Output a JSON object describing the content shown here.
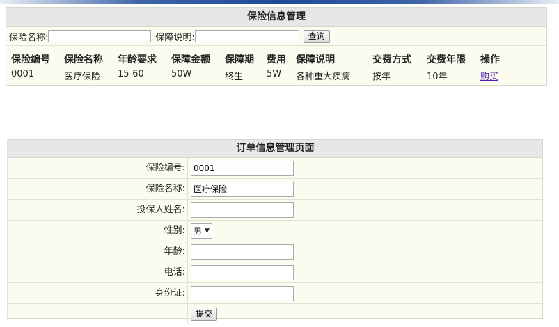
{
  "insurance_panel": {
    "title": "保险信息管理",
    "search": {
      "name_label": "保险名称:",
      "desc_label": "保障说明:",
      "name_value": "",
      "desc_value": "",
      "query_button": "查询"
    },
    "columns": [
      "保险编号",
      "保险名称",
      "年龄要求",
      "保障金额",
      "保障期",
      "费用",
      "保障说明",
      "交费方式",
      "交费年限",
      "操作"
    ],
    "rows": [
      {
        "id": "0001",
        "name": "医疗保险",
        "age": "15-60",
        "amount": "50W",
        "period": "终生",
        "cost": "5W",
        "desc": "各种重大疾病",
        "pay_method": "按年",
        "pay_years": "10年",
        "action": "购买"
      }
    ]
  },
  "order_panel": {
    "title": "订单信息管理页面",
    "fields": {
      "insurance_id": {
        "label": "保险编号:",
        "value": "0001"
      },
      "insurance_name": {
        "label": "保险名称:",
        "value": "医疗保险"
      },
      "applicant_name": {
        "label": "投保人姓名:",
        "value": ""
      },
      "gender": {
        "label": "性别:",
        "value": "男"
      },
      "age": {
        "label": "年龄:",
        "value": ""
      },
      "phone": {
        "label": "电话:",
        "value": ""
      },
      "id_card": {
        "label": "身份证:",
        "value": ""
      }
    },
    "submit_button": "提交"
  }
}
